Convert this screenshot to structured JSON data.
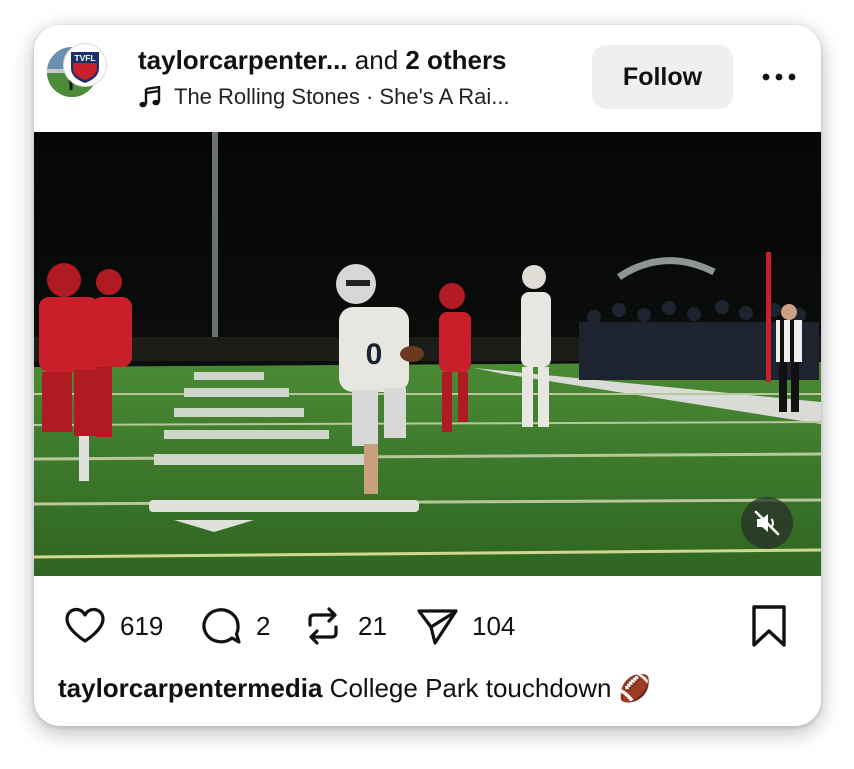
{
  "post": {
    "author_line": {
      "username": "taylorcarpenter...",
      "connector": " and ",
      "others": "2 others"
    },
    "music": {
      "icon": "music-note-icon",
      "text": "The Rolling Stones · She's A Rai..."
    },
    "avatar_badge_text": "TVFL",
    "follow_label": "Follow",
    "more_icon": "more-horizontal-icon",
    "media": {
      "muted_icon": "speaker-muted-icon"
    },
    "actions": {
      "likes": "619",
      "comments": "2",
      "reposts": "21",
      "shares": "104"
    },
    "caption": {
      "username": "taylorcarpentermedia",
      "text": " College Park touchdown 🏈"
    }
  },
  "colors": {
    "field_green": "#3f7a2a",
    "jersey_red": "#c8202a",
    "jersey_white": "#e8e6e0",
    "follow_bg": "#efefef"
  }
}
